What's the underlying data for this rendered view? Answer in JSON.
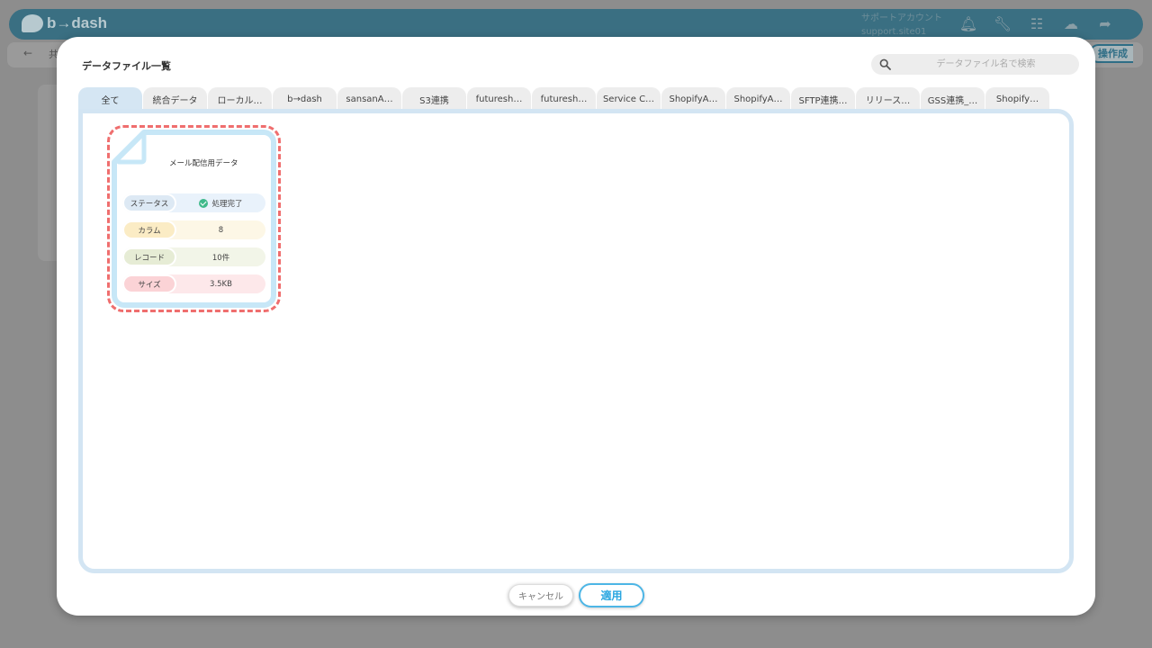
{
  "background": {
    "logo_text": "b→dash",
    "account_name": "サポートアカウント",
    "account_site": "support.site01",
    "icons": [
      "bell-icon",
      "wrench-icon",
      "grid-icon",
      "help-icon",
      "logout-icon"
    ],
    "breadcrumb": "共",
    "action_label": "操作成"
  },
  "modal": {
    "title": "データファイル一覧",
    "search": {
      "placeholder": "データファイル名で検索",
      "value": ""
    },
    "tabs": [
      {
        "label": "全て",
        "active": true
      },
      {
        "label": "統合データ"
      },
      {
        "label": "ローカル…"
      },
      {
        "label": "b→dash"
      },
      {
        "label": "sansanA…"
      },
      {
        "label": "S3連携"
      },
      {
        "label": "futuresh…"
      },
      {
        "label": "futuresh…"
      },
      {
        "label": "Service C…"
      },
      {
        "label": "ShopifyA…"
      },
      {
        "label": "ShopifyA…"
      },
      {
        "label": "SFTP連携…"
      },
      {
        "label": "リリース…"
      },
      {
        "label": "GSS連携_…"
      },
      {
        "label": "Shopify…"
      }
    ],
    "file_card": {
      "title": "メール配信用データ",
      "status": {
        "label": "ステータス",
        "value": "処理完了"
      },
      "column": {
        "label": "カラム",
        "value": "8"
      },
      "record": {
        "label": "レコード",
        "value": "10件"
      },
      "size": {
        "label": "サイズ",
        "value": "3.5KB"
      }
    },
    "buttons": {
      "cancel": "キャンセル",
      "apply": "適用"
    }
  },
  "colors": {
    "accent": "#4db6e6",
    "highlight": "#ef6e6e",
    "header": "#3a6f82"
  }
}
